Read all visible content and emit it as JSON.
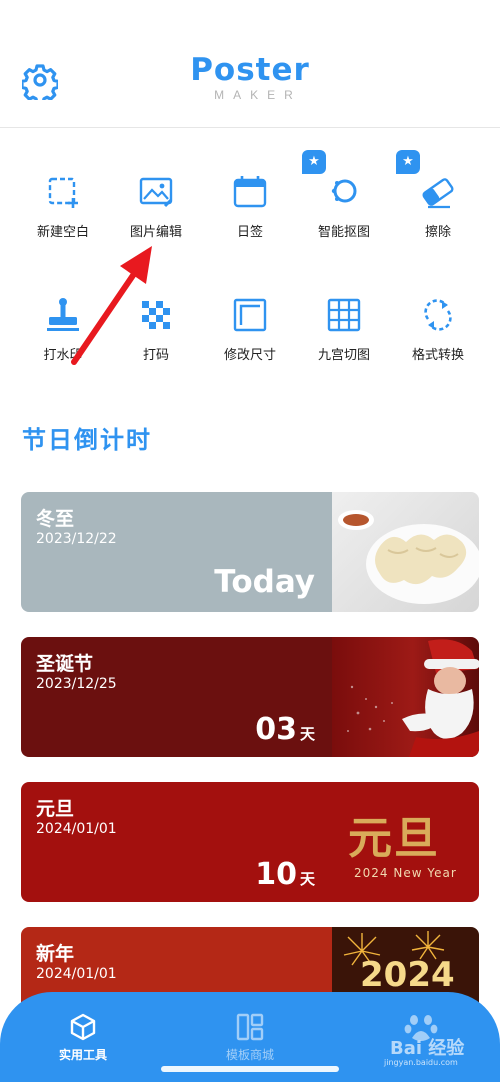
{
  "header": {
    "logo_main": "Poster",
    "logo_sub": "MAKER",
    "settings_icon": "gear-icon"
  },
  "tools": [
    {
      "label": "新建空白",
      "icon": "new-blank-icon",
      "starred": false
    },
    {
      "label": "图片编辑",
      "icon": "image-edit-icon",
      "starred": false
    },
    {
      "label": "日签",
      "icon": "calendar-icon",
      "starred": false
    },
    {
      "label": "智能抠图",
      "icon": "smart-cutout-icon",
      "starred": true
    },
    {
      "label": "擦除",
      "icon": "eraser-icon",
      "starred": true
    },
    {
      "label": "打水印",
      "icon": "stamp-icon",
      "starred": false
    },
    {
      "label": "打码",
      "icon": "mosaic-icon",
      "starred": false
    },
    {
      "label": "修改尺寸",
      "icon": "resize-icon",
      "starred": false
    },
    {
      "label": "九宫切图",
      "icon": "grid-nine-icon",
      "starred": false
    },
    {
      "label": "格式转换",
      "icon": "convert-icon",
      "starred": false
    }
  ],
  "badge_star": "★",
  "section": {
    "title": "节日倒计时"
  },
  "holidays": [
    {
      "name": "冬至",
      "date": "2023/12/22",
      "countdown": "Today",
      "unit": "",
      "bg": "#a9b7bd",
      "image": "dumplings-photo"
    },
    {
      "name": "圣诞节",
      "date": "2023/12/25",
      "countdown": "03",
      "unit": "天",
      "bg": "#6b100f",
      "image": "santa-photo"
    },
    {
      "name": "元旦",
      "date": "2024/01/01",
      "countdown": "10",
      "unit": "天",
      "bg": "#a3100e",
      "image": "new-year-calligraphy",
      "image_title": "元旦",
      "image_caption": "2024 New Year"
    },
    {
      "name": "新年",
      "date": "2024/01/01",
      "countdown": "",
      "unit": "",
      "bg": "#b42816",
      "image": "fireworks-photo",
      "image_title": "2024"
    }
  ],
  "tabbar": {
    "tabs": [
      {
        "label": "实用工具",
        "icon": "cube-icon",
        "active": true
      },
      {
        "label": "模板商城",
        "icon": "template-icon",
        "active": false
      }
    ],
    "watermark": {
      "text": "Bai 经验",
      "url": "jingyan.baidu.com"
    }
  },
  "colors": {
    "accent": "#2f93f0",
    "annotation_arrow": "#e8191f"
  }
}
